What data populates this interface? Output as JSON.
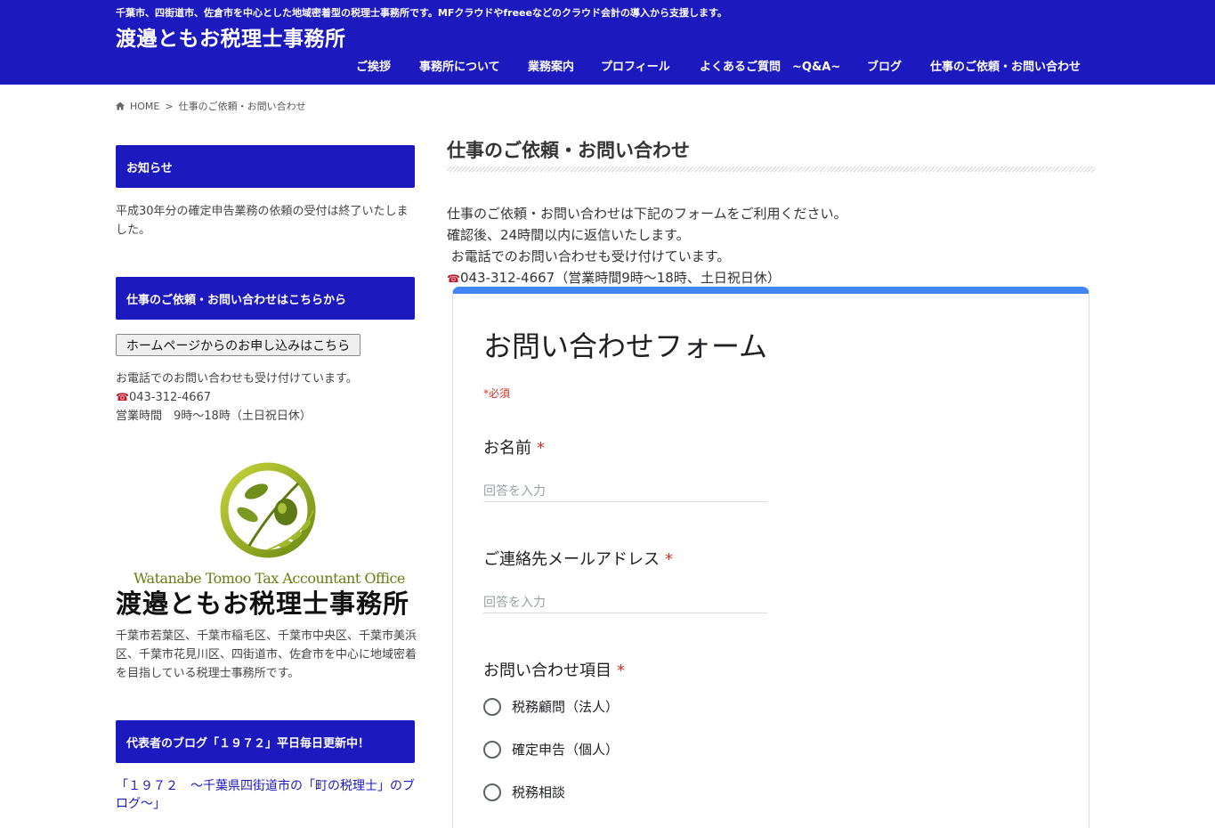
{
  "header": {
    "tagline": "千葉市、四街道市、佐倉市を中心とした地域密着型の税理士事務所です。MFクラウドやfreeeなどのクラウド会計の導入から支援します。",
    "title": "渡邉ともお税理士事務所",
    "nav": [
      "ご挨拶",
      "事務所について",
      "業務案内",
      "プロフィール",
      "よくあるご質問　~Q&A~",
      "ブログ",
      "仕事のご依頼・お問い合わせ"
    ]
  },
  "breadcrumb": {
    "home": "HOME",
    "separator": ">",
    "current": "仕事のご依頼・お問い合わせ"
  },
  "sidebar": {
    "news_heading": "お知らせ",
    "news_text": "平成30年分の確定申告業務の依頼の受付は終了いたしました。",
    "contact_heading": "仕事のご依頼・お問い合わせはこちらから",
    "contact_button": "ホームページからのお申し込みはこちら",
    "phone_note": "お電話でのお問い合わせも受け付けています。",
    "phone": "043-312-4667",
    "hours": "営業時間　9時～18時（土日祝日休）",
    "logo_en": "Watanabe Tomoo Tax Accountant Office",
    "logo_jp": "渡邉ともお税理士事務所",
    "office_desc": "千葉市若葉区、千葉市稲毛区、千葉市中央区、千葉市美浜区、千葉市花見川区、四街道市、佐倉市を中心に地域密着を目指している税理士事務所です。",
    "blog_heading": "代表者のブログ「１９７２」平日毎日更新中！",
    "blog_link": "「１９７２　～千葉県四街道市の「町の税理士」のブログ～」"
  },
  "main": {
    "page_title": "仕事のご依頼・お問い合わせ",
    "intro": [
      "仕事のご依頼・お問い合わせは下記のフォームをご利用ください。",
      "確認後、24時間以内に返信いたします。",
      " お電話でのお問い合わせも受け付けています。"
    ],
    "phone": "043-312-4667",
    "phone_hours": "（営業時間9時～18時、土日祝日休）"
  },
  "form": {
    "title": "お問い合わせフォーム",
    "required_note": "*必須",
    "q_name": "お名前",
    "q_email": "ご連絡先メールアドレス",
    "q_topic": "お問い合わせ項目",
    "required_mark": "*",
    "placeholder": "回答を入力",
    "options": [
      "税務顧問（法人）",
      "確定申告（個人）",
      "税務相談"
    ]
  },
  "colors": {
    "brand_blue": "#1c19be",
    "form_accent": "#4285f4",
    "required_red": "#d93025"
  }
}
